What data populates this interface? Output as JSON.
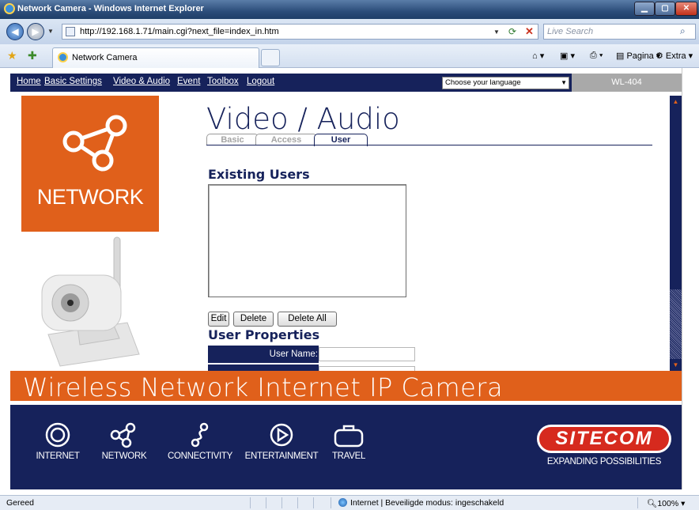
{
  "browser": {
    "window_title": "Network Camera - Windows Internet Explorer",
    "url": "http://192.168.1.71/main.cgi?next_file=index_in.htm",
    "search_placeholder": "Live Search",
    "tab_title": "Network Camera",
    "commands": [
      "Pagina",
      "Extra"
    ],
    "status_text": "Gereed",
    "zone_text": "Internet | Beveiligde modus: ingeschakeld",
    "zoom": "100%"
  },
  "camera_nav": {
    "links": [
      "Home",
      "Basic Settings",
      "Video & Audio",
      "Event",
      "Toolbox",
      "Logout"
    ],
    "language_select": "Choose your language",
    "model": "WL-404"
  },
  "left_panel": {
    "label": "NETWORK"
  },
  "content": {
    "title": "Video / Audio",
    "tabs": [
      "Basic",
      "Access",
      "User"
    ],
    "active_tab": "User",
    "existing_users_heading": "Existing Users",
    "buttons": {
      "edit": "Edit",
      "delete": "Delete",
      "delete_all": "Delete All"
    },
    "user_properties_heading": "User Properties",
    "username_label": "User Name:",
    "username_value": ""
  },
  "banner": {
    "text": "Wireless Network Internet IP Camera"
  },
  "footer": {
    "items": [
      "INTERNET",
      "NETWORK",
      "CONNECTIVITY",
      "ENTERTAINMENT",
      "TRAVEL"
    ],
    "brand": "SITECOM",
    "tagline": "EXPANDING POSSIBILITIES"
  },
  "colors": {
    "navy": "#16225b",
    "orange": "#e0601b",
    "brand_red": "#d62a1e"
  }
}
